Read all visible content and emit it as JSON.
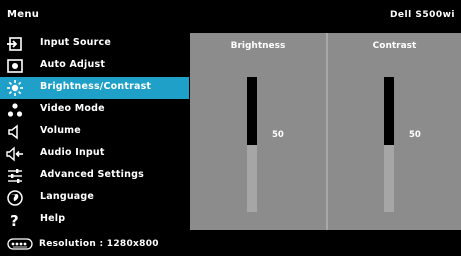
{
  "title": {
    "menu": "Menu",
    "model": "Dell S500wi"
  },
  "menu_items": [
    {
      "label": "Input Source",
      "icon": "input-source-icon",
      "selected": false
    },
    {
      "label": "Auto Adjust",
      "icon": "auto-adjust-icon",
      "selected": false
    },
    {
      "label": "Brightness/Contrast",
      "icon": "brightness-icon",
      "selected": true
    },
    {
      "label": "Video Mode",
      "icon": "video-mode-icon",
      "selected": false
    },
    {
      "label": "Volume",
      "icon": "volume-icon",
      "selected": false
    },
    {
      "label": "Audio Input",
      "icon": "audio-input-icon",
      "selected": false
    },
    {
      "label": "Advanced Settings",
      "icon": "advanced-settings-icon",
      "selected": false
    },
    {
      "label": "Language",
      "icon": "language-icon",
      "selected": false
    },
    {
      "label": "Help",
      "icon": "help-icon",
      "selected": false
    }
  ],
  "brightness": {
    "label": "Brightness",
    "value": "50",
    "level": 0.5
  },
  "contrast": {
    "label": "Contrast",
    "value": "50",
    "level": 0.5
  },
  "status": {
    "text": "Resolution : 1280x800",
    "icon": "resolution-icon"
  },
  "colors": {
    "selected": "#1fa0c8",
    "panel": "#8c8c8c",
    "bar_fill": "#000000",
    "bar_track": "#a6a6a6"
  }
}
